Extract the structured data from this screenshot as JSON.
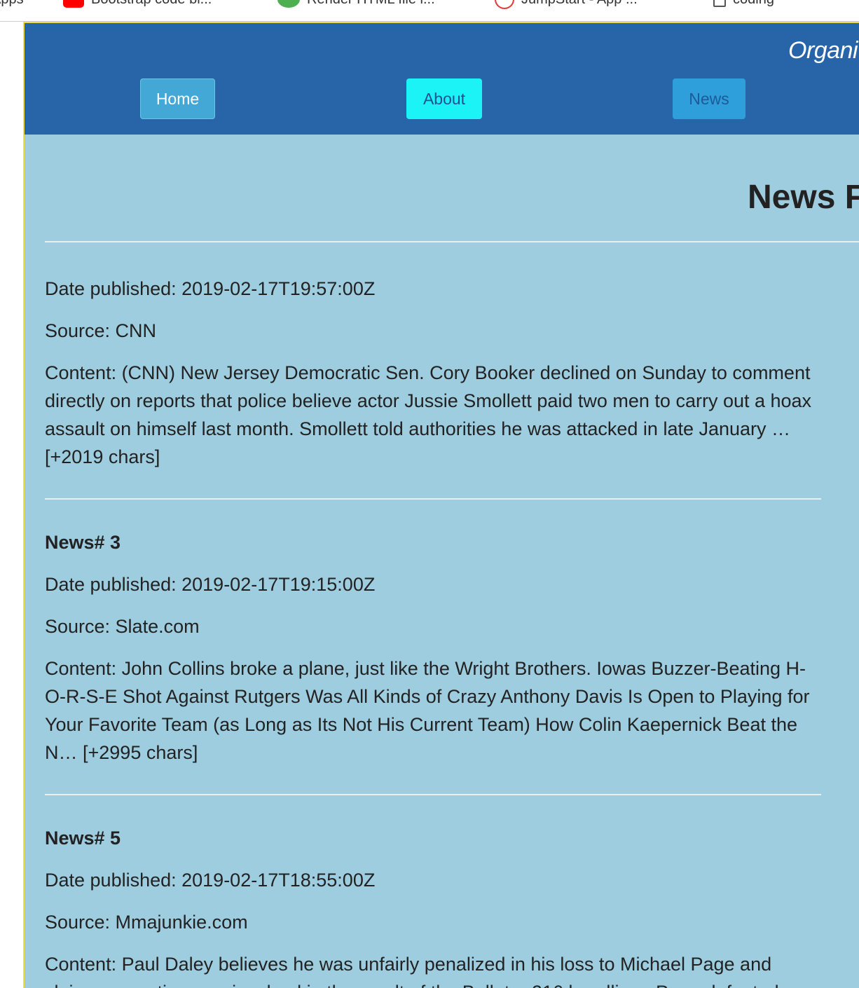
{
  "bookmarks": [
    {
      "label": "Apps",
      "icon": "apps-icon"
    },
    {
      "label": "Bootstrap code bl...",
      "icon": "youtube-icon"
    },
    {
      "label": "Render HTML file i...",
      "icon": "green-leaf-icon"
    },
    {
      "label": "JumpStart - App ...",
      "icon": "jumpstart-icon"
    },
    {
      "label": "coding",
      "icon": "document-icon"
    }
  ],
  "header": {
    "brand": "Organi",
    "nav": [
      {
        "label": "Home"
      },
      {
        "label": "About"
      },
      {
        "label": "News"
      }
    ]
  },
  "main": {
    "title": "News F",
    "articles": [
      {
        "heading": "",
        "date": "Date published: 2019-02-17T19:57:00Z",
        "source": "Source: CNN",
        "content": "Content: (CNN) New Jersey Democratic Sen. Cory Booker declined on Sunday to comment directly on reports that police believe actor Jussie Smollett paid two men to carry out a hoax assault on himself last month. Smollett told authorities he was attacked in late January … [+2019 chars]"
      },
      {
        "heading": "News# 3",
        "date": "Date published: 2019-02-17T19:15:00Z",
        "source": "Source: Slate.com",
        "content": "Content: John Collins broke a plane, just like the Wright Brothers. Iowas Buzzer-Beating H-O-R-S-E Shot Against Rutgers Was All Kinds of Crazy Anthony Davis Is Open to Playing for Your Favorite Team (as Long as Its Not His Current Team) How Colin Kaepernick Beat the N… [+2995 chars]"
      },
      {
        "heading": "News# 5",
        "date": "Date published: 2019-02-17T18:55:00Z",
        "source": "Source: Mmajunkie.com",
        "content": "Content: Paul Daley believes he was unfairly penalized in his loss to Michael Page and claims corruption was involved in the result of the Bellator 216 headliner. Page defeated"
      }
    ]
  }
}
